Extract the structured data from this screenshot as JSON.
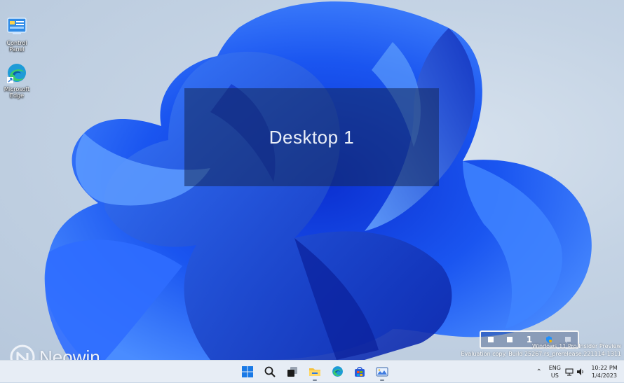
{
  "desktop": {
    "icons": [
      {
        "label_line1": "Control",
        "label_line2": "Panel",
        "icon": "control-panel-icon"
      },
      {
        "label_line1": "Microsoft",
        "label_line2": "Edge",
        "icon": "edge-icon"
      }
    ],
    "overlay_label": "Desktop 1",
    "virtual_desktops": {
      "current": "1"
    },
    "watermark": {
      "line1": "Windows 11 Pro Insider Preview",
      "line2": "Evaluation copy. Build 25267.rs_prerelease.221114-1311"
    },
    "brand": "Neowin"
  },
  "taskbar": {
    "apps": [
      {
        "name": "start",
        "icon": "windows-start-icon",
        "running": false
      },
      {
        "name": "search",
        "icon": "search-icon",
        "running": false
      },
      {
        "name": "task-view",
        "icon": "task-view-icon",
        "running": false
      },
      {
        "name": "file-explorer",
        "icon": "folder-icon",
        "running": true
      },
      {
        "name": "edge",
        "icon": "edge-icon",
        "running": false
      },
      {
        "name": "store",
        "icon": "store-icon",
        "running": false
      },
      {
        "name": "photos",
        "icon": "photos-icon",
        "running": true
      }
    ],
    "tray": {
      "language_line1": "ENG",
      "language_line2": "US",
      "time": "10:22 PM",
      "date": "1/4/2023"
    }
  },
  "colors": {
    "accent": "#1a5cff",
    "taskbar_bg": "#e7edf5"
  }
}
